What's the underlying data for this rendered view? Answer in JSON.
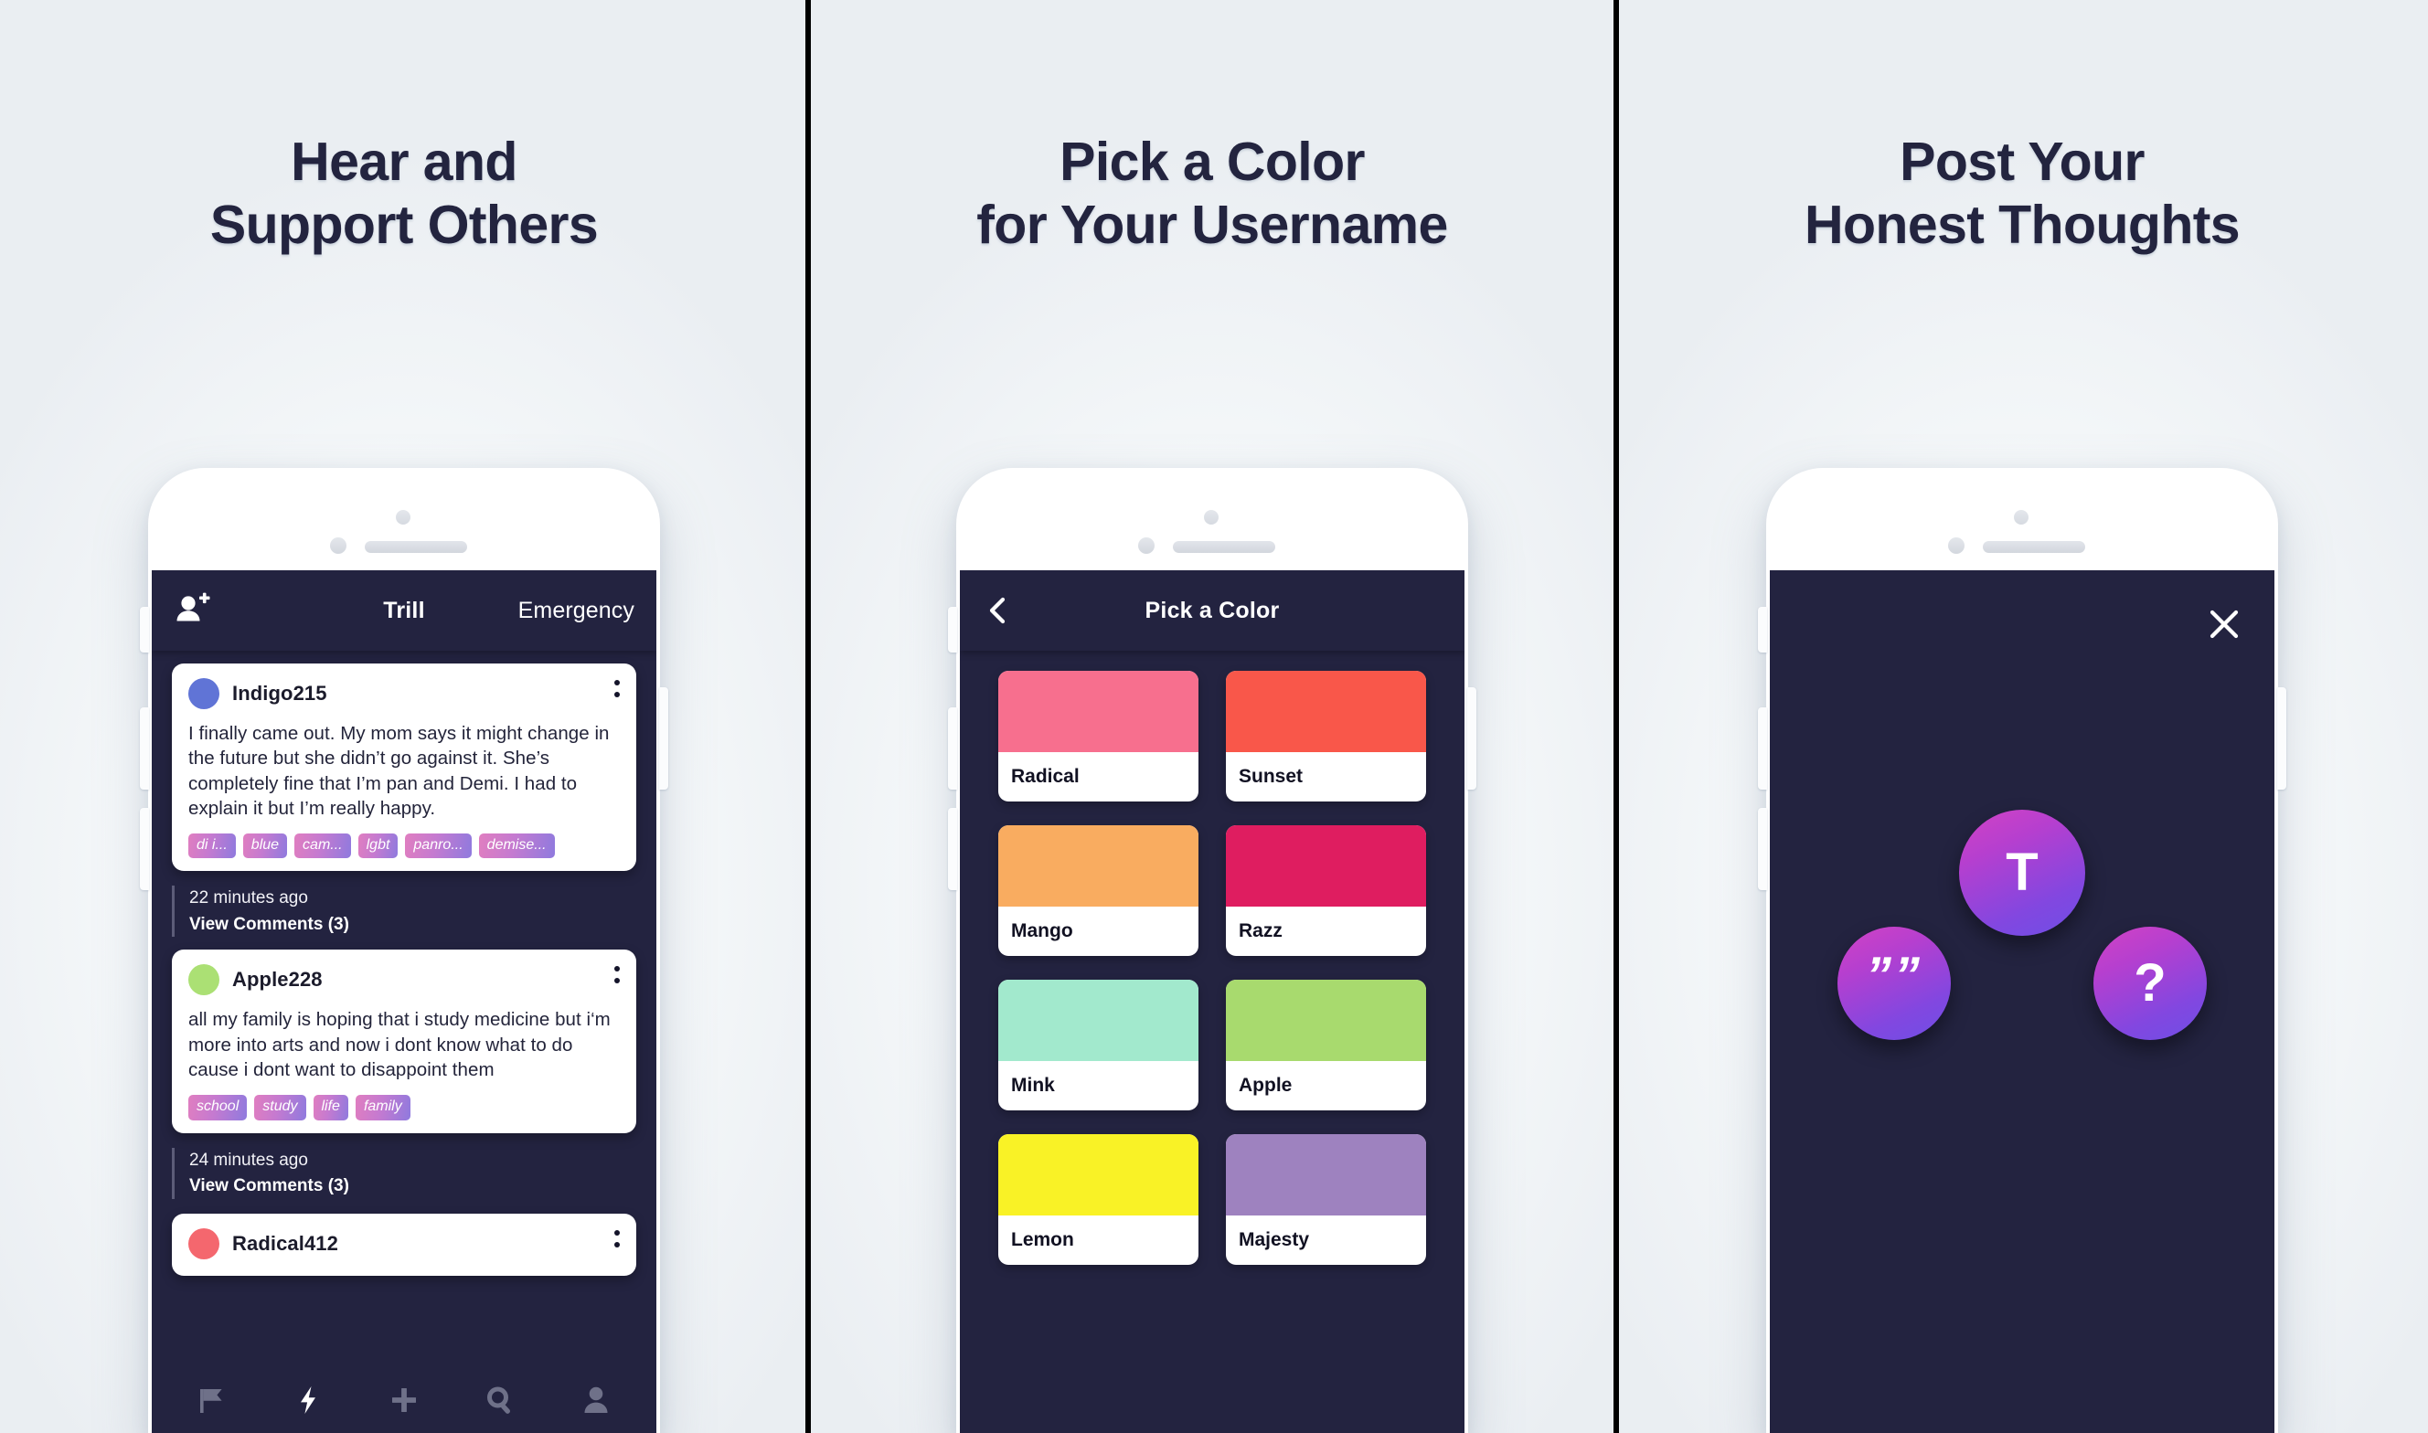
{
  "panels": [
    {
      "heading": "Hear and\nSupport Others",
      "screen": "feed"
    },
    {
      "heading": "Pick a Color\nfor Your Username",
      "screen": "color-picker"
    },
    {
      "heading": "Post Your\nHonest Thoughts",
      "screen": "compose"
    }
  ],
  "feed": {
    "appbar": {
      "add_friend_icon": "person-add-icon",
      "title": "Trill",
      "right_action": "Emergency"
    },
    "posts": [
      {
        "username": "Indigo215",
        "avatar_color": "#6074d6",
        "body": "I finally came out. My mom says it might change in the future but she didn’t go against it. She’s completely fine that I’m pan and Demi. I had to explain it but I’m really happy.",
        "tags": [
          "di i...",
          "blue",
          "cam...",
          "lgbt",
          "panro...",
          "demise..."
        ],
        "time": "22 minutes ago",
        "comments": "View Comments (3)"
      },
      {
        "username": "Apple228",
        "avatar_color": "#abe074",
        "body": "all my family is hoping that i study medicine but i‘m more into arts and now i dont know what to do cause i dont want to disappoint them",
        "tags": [
          "school",
          "study",
          "life",
          "family"
        ],
        "time": "24 minutes ago",
        "comments": "View Comments (3)"
      },
      {
        "username": "Radical412",
        "avatar_color": "#f4676e",
        "body": "",
        "tags": [],
        "time": "",
        "comments": ""
      }
    ],
    "tabbar": [
      {
        "icon": "flag-icon",
        "active": false
      },
      {
        "icon": "lightning-bolt-icon",
        "active": true
      },
      {
        "icon": "plus-icon",
        "active": false
      },
      {
        "icon": "search-icon",
        "active": false
      },
      {
        "icon": "person-icon",
        "active": false
      }
    ]
  },
  "color_picker": {
    "back_icon": "chevron-left-icon",
    "title": "Pick a Color",
    "swatches": [
      {
        "name": "Radical",
        "hex": "#f76f8e"
      },
      {
        "name": "Sunset",
        "hex": "#f9574a"
      },
      {
        "name": "Mango",
        "hex": "#f9ac60"
      },
      {
        "name": "Razz",
        "hex": "#df1d60"
      },
      {
        "name": "Mink",
        "hex": "#a2e9cd"
      },
      {
        "name": "Apple",
        "hex": "#a8da6e"
      },
      {
        "name": "Lemon",
        "hex": "#f9f226"
      },
      {
        "name": "Majesty",
        "hex": "#9e82bf"
      }
    ]
  },
  "compose": {
    "close_icon": "close-icon",
    "buttons": [
      {
        "name": "text-post-button",
        "glyph": "T"
      },
      {
        "name": "quote-post-button",
        "glyph": "””"
      },
      {
        "name": "question-post-button",
        "glyph": "?"
      }
    ]
  },
  "theme": {
    "screen_bg": "#232340",
    "heading_color": "#23243f",
    "page_bg": "#eceff3",
    "divider_color": "#000000",
    "tag_gradient_from": "#e07ec0",
    "tag_gradient_to": "#8f7ade",
    "bubble_gradient_from": "#d243c4",
    "bubble_gradient_to": "#6e4fe6"
  }
}
